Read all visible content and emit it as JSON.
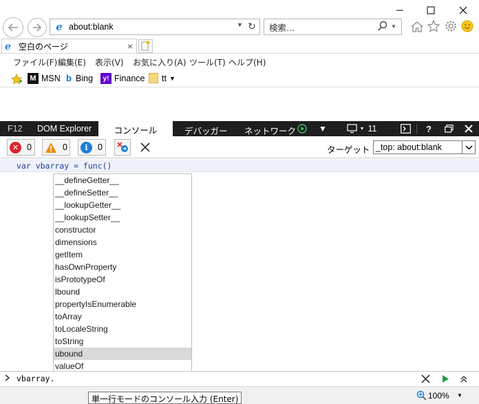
{
  "window": {
    "controls": {
      "minimize": "minimize-icon",
      "maximize": "maximize-icon",
      "close": "close-icon"
    }
  },
  "nav": {
    "back_icon": "back-arrow-icon",
    "forward_icon": "forward-arrow-icon",
    "address": "about:blank",
    "search_placeholder": "検索...",
    "icons": [
      "home-icon",
      "star-icon",
      "gear-icon",
      "smiley-icon"
    ]
  },
  "tab": {
    "title": "空白のページ",
    "close": "×"
  },
  "menu": [
    "ファイル(F)",
    "編集(E)",
    "表示(V)",
    "お気に入り(A)",
    "ツール(T)",
    "ヘルプ(H)"
  ],
  "favorites": [
    {
      "label": "MSN",
      "icon": "msn-icon"
    },
    {
      "label": "Bing",
      "icon": "bing-icon"
    },
    {
      "label": "Finance",
      "icon": "yahoo-icon"
    },
    {
      "label": "tt",
      "icon": "folder-icon"
    }
  ],
  "devtools": {
    "tabs": [
      "F12",
      "DOM Explorer",
      "コンソール",
      "デバッガー",
      "ネットワーク"
    ],
    "active_tab": "コンソール",
    "emulation_count": "11",
    "counts": {
      "errors": "0",
      "warnings": "0",
      "info": "0"
    },
    "target_label": "ターゲット",
    "target_value": "_top: about:blank"
  },
  "console": {
    "command": "var vbarray = func()",
    "input": "vbarray.",
    "autocomplete": [
      "__defineGetter__",
      "__defineSetter__",
      "__lookupGetter__",
      "__lookupSetter__",
      "constructor",
      "dimensions",
      "getItem",
      "hasOwnProperty",
      "isPrototypeOf",
      "lbound",
      "propertyIsEnumerable",
      "toArray",
      "toLocaleString",
      "toString",
      "ubound",
      "valueOf"
    ],
    "selected_item": "ubound",
    "tooltip": "単一行モードのコンソール入力 (Enter)"
  },
  "status": {
    "zoom": "100%"
  },
  "colors": {
    "accent_blue": "#1e7fd8",
    "error_red": "#d9262c",
    "warning_orange": "#f08b00",
    "devtools_dark": "#1e1e1e",
    "run_green": "#1aa33e"
  }
}
